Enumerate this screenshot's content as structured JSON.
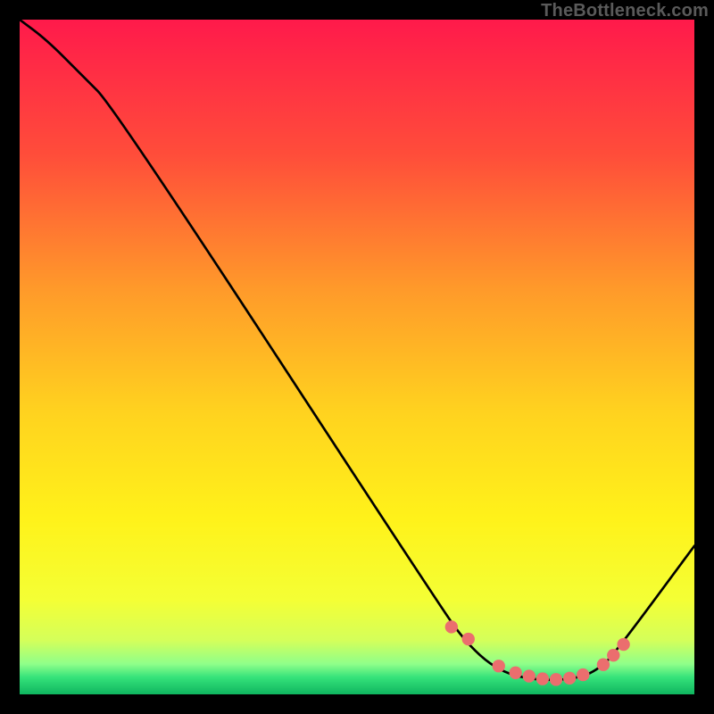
{
  "attribution": "TheBottleneck.com",
  "colors": {
    "frame": "#000000",
    "curve": "#000000",
    "marker": "#eb6e6e",
    "gradient_stops": [
      {
        "offset": 0.0,
        "color": "#ff1a4b"
      },
      {
        "offset": 0.2,
        "color": "#ff4d3a"
      },
      {
        "offset": 0.4,
        "color": "#ff9a2a"
      },
      {
        "offset": 0.58,
        "color": "#ffd21f"
      },
      {
        "offset": 0.74,
        "color": "#fff21a"
      },
      {
        "offset": 0.86,
        "color": "#f4ff35"
      },
      {
        "offset": 0.92,
        "color": "#d4ff5a"
      },
      {
        "offset": 0.955,
        "color": "#8fff8a"
      },
      {
        "offset": 0.975,
        "color": "#35e27a"
      },
      {
        "offset": 1.0,
        "color": "#0fb55f"
      }
    ]
  },
  "chart_data": {
    "type": "line",
    "title": "",
    "xlabel": "",
    "ylabel": "",
    "xlim": [
      0,
      100
    ],
    "ylim": [
      0,
      100
    ],
    "series": [
      {
        "name": "bottleneck-curve",
        "x": [
          0,
          4,
          9,
          14,
          63,
          66,
          69,
          72,
          75,
          78,
          81,
          84,
          86,
          88,
          100
        ],
        "y": [
          100,
          97,
          92,
          87,
          12,
          8,
          5,
          3.2,
          2.4,
          2.1,
          2.2,
          2.8,
          4.0,
          5.8,
          22
        ]
      }
    ],
    "markers": {
      "name": "optimal-zone",
      "x": [
        64,
        66.5,
        71,
        73.5,
        75.5,
        77.5,
        79.5,
        81.5,
        83.5,
        86.5,
        88,
        89.5
      ],
      "y": [
        10,
        8.2,
        4.2,
        3.2,
        2.7,
        2.3,
        2.2,
        2.4,
        2.9,
        4.4,
        5.8,
        7.4
      ]
    }
  }
}
